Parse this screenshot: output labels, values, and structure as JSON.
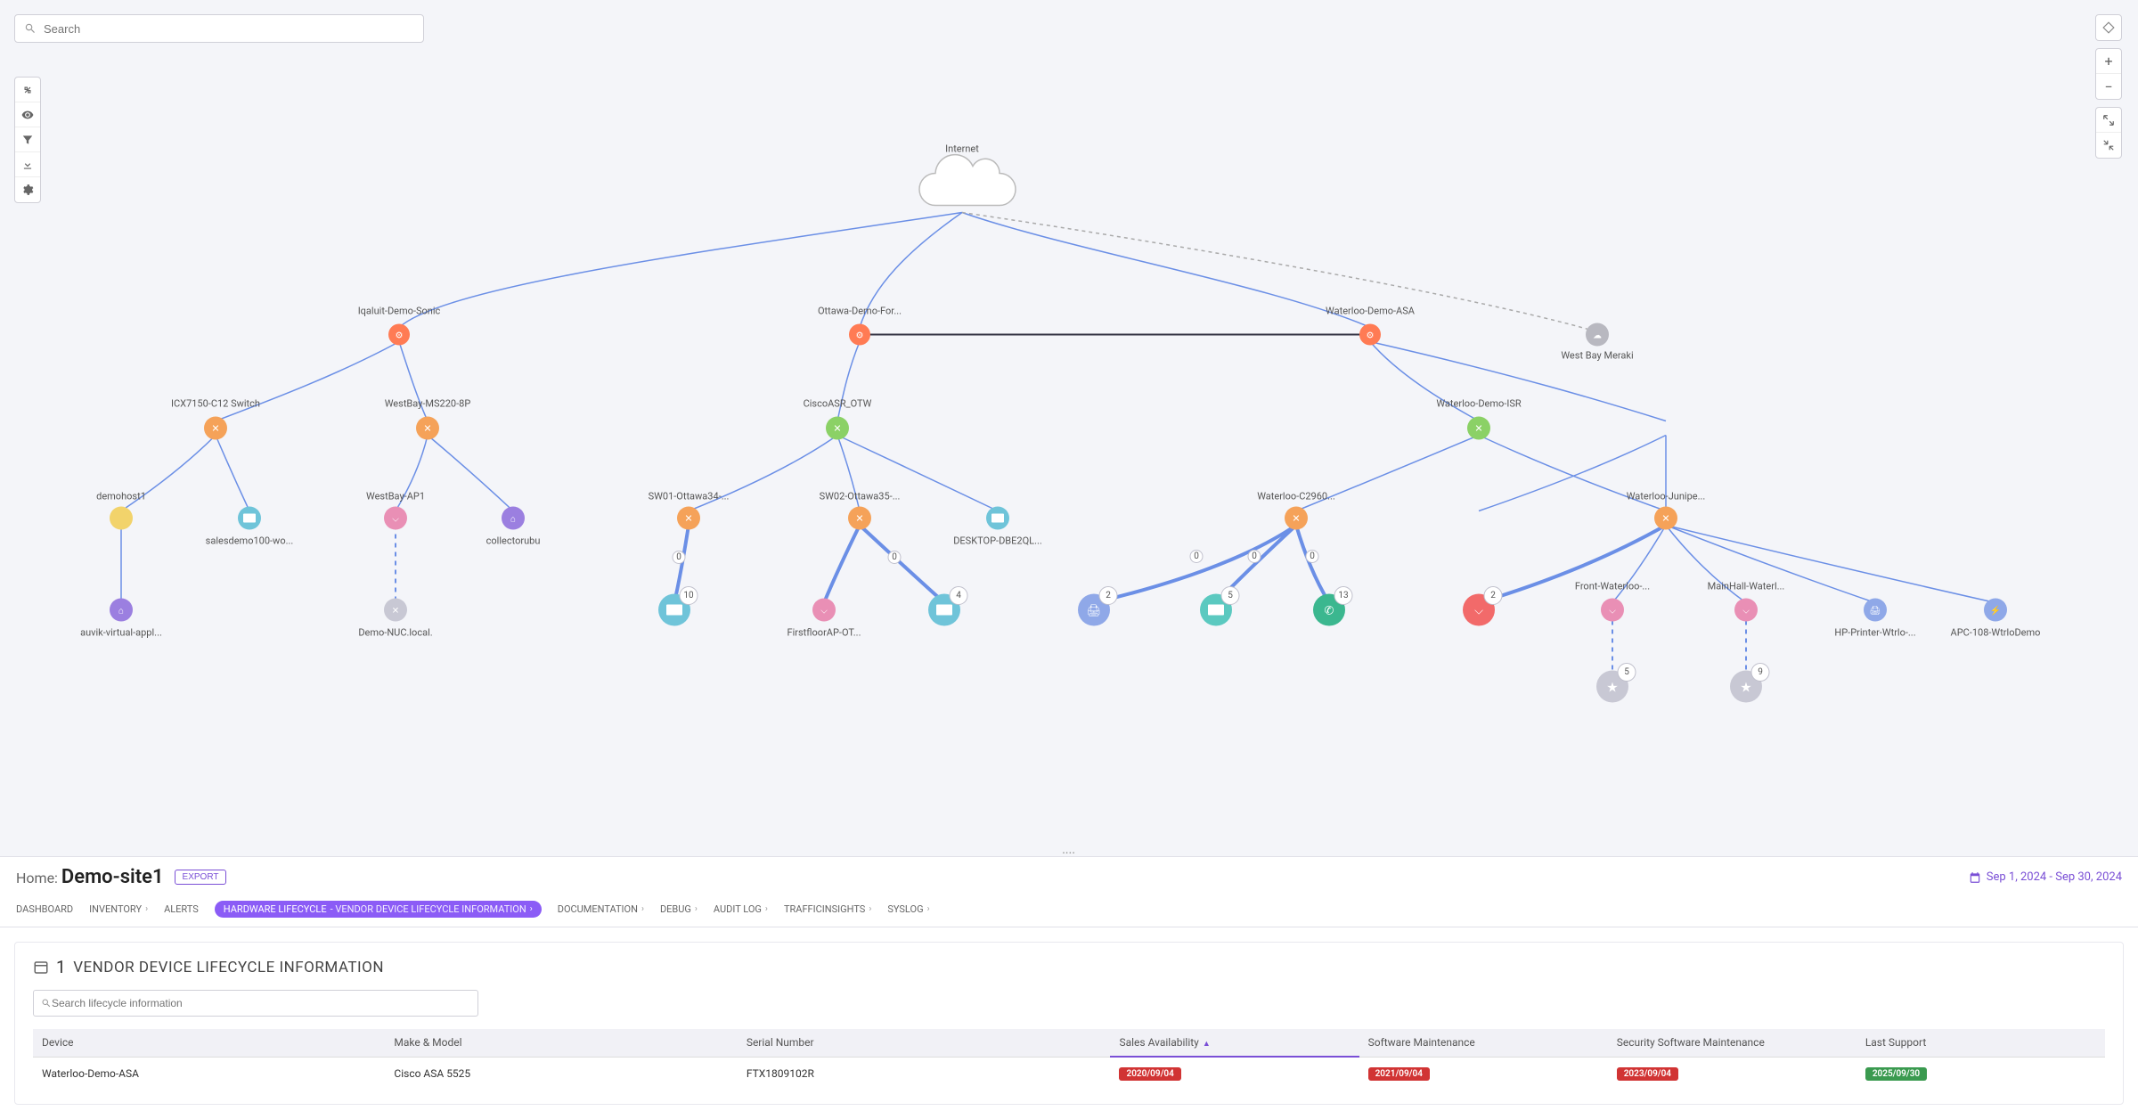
{
  "search": {
    "placeholder": "Search"
  },
  "topology": {
    "internet": "Internet",
    "nodes": {
      "iqaluit": "Iqaluit-Demo-Sonic",
      "ottawa_for": "Ottawa-Demo-For...",
      "waterloo_asa": "Waterloo-Demo-ASA",
      "west_bay_meraki": "West Bay Meraki",
      "icx": "ICX7150-C12 Switch",
      "westbay_ms220": "WestBay-MS220-8P",
      "ciscoasr": "CiscoASR_OTW",
      "waterloo_isr": "Waterloo-Demo-ISR",
      "demohost1": "demohost1",
      "salesdemo": "salesdemo100-wo...",
      "westbay_ap1": "WestBay-AP1",
      "collectorubu": "collectorubu",
      "sw01": "SW01-Ottawa34-...",
      "sw02": "SW02-Ottawa35-...",
      "desktop": "DESKTOP-DBE2QL...",
      "waterloo_c2960": "Waterloo-C2960...",
      "waterloo_junipe": "Waterloo-Junipe...",
      "auvik": "auvik-virtual-appl...",
      "demo_nuc": "Demo-NUC.local.",
      "firstfloor": "FirstfloorAP-OT...",
      "front_waterloo": "Front-Waterloo-...",
      "mainhall": "MainHall-Waterl...",
      "hp_printer": "HP-Printer-Wtrlo-...",
      "apc108": "APC-108-WtrloDemo"
    },
    "counts": {
      "sw01_10": "10",
      "sw02_4": "4",
      "printer_2": "2",
      "teal_5": "5",
      "phone_13": "13",
      "wifi_2": "2",
      "front_5": "5",
      "mainhall_9": "9",
      "s1": "0",
      "s2": "0",
      "s3": "0",
      "s4": "0",
      "s5": "0"
    }
  },
  "header": {
    "home_prefix": "Home: ",
    "home_name": "Demo-site1",
    "export": "EXPORT",
    "date_range": "Sep 1, 2024 - Sep 30, 2024"
  },
  "tabs": {
    "dashboard": "DASHBOARD",
    "inventory": "INVENTORY",
    "alerts": "ALERTS",
    "hardware": "HARDWARE LIFECYCLE",
    "hardware_sub": " - VENDOR DEVICE LIFECYCLE INFORMATION",
    "documentation": "DOCUMENTATION",
    "debug": "DEBUG",
    "audit": "AUDIT LOG",
    "traffic": "TRAFFICINSIGHTS",
    "syslog": "SYSLOG"
  },
  "card": {
    "count": "1",
    "title": "VENDOR DEVICE LIFECYCLE INFORMATION",
    "filter_placeholder": "Search lifecycle information",
    "columns": {
      "device": "Device",
      "make": "Make & Model",
      "serial": "Serial Number",
      "sales": "Sales Availability",
      "software": "Software Maintenance",
      "security": "Security Software Maintenance",
      "last": "Last Support"
    },
    "rows": [
      {
        "device": "Waterloo-Demo-ASA",
        "make": "Cisco ASA 5525",
        "serial": "FTX1809102R",
        "sales": "2020/09/04",
        "software": "2021/09/04",
        "security": "2023/09/04",
        "last": "2025/09/30"
      }
    ]
  }
}
